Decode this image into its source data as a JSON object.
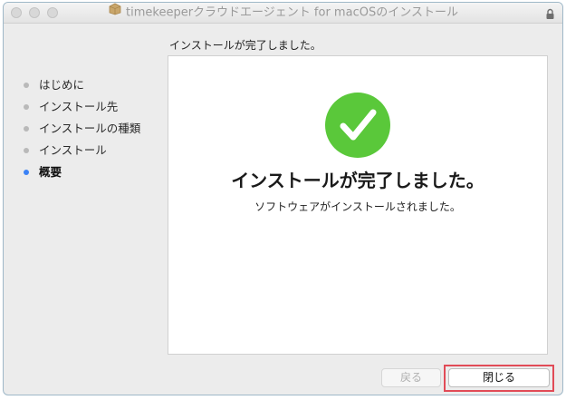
{
  "window": {
    "title": "timekeeperクラウドエージェント for macOSのインストール"
  },
  "header": {
    "status_text": "インストールが完了しました。"
  },
  "sidebar": {
    "items": [
      {
        "label": "はじめに",
        "active": false
      },
      {
        "label": "インストール先",
        "active": false
      },
      {
        "label": "インストールの種類",
        "active": false
      },
      {
        "label": "インストール",
        "active": false
      },
      {
        "label": "概要",
        "active": true
      }
    ]
  },
  "main": {
    "headline": "インストールが完了しました。",
    "subline": "ソフトウェアがインストールされました。"
  },
  "buttons": {
    "back_label": "戻る",
    "close_label": "閉じる"
  },
  "colors": {
    "success_green": "#5ac83a",
    "active_step": "#3b82f6",
    "highlight_border": "#e14b57"
  }
}
